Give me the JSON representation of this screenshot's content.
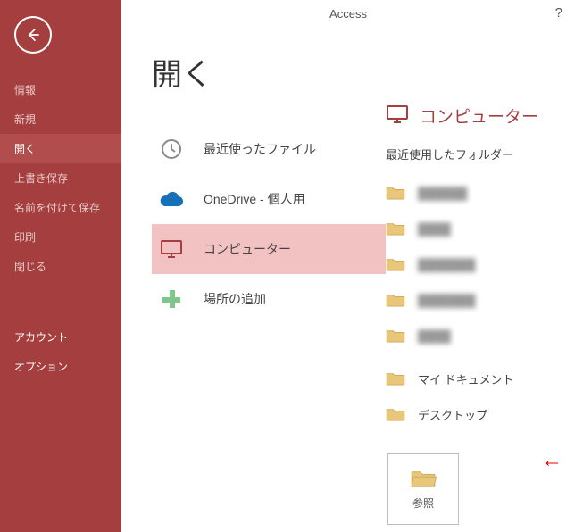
{
  "app_title": "Access",
  "help_symbol": "?",
  "page_title": "開く",
  "sidebar": {
    "items": [
      {
        "label": "情報"
      },
      {
        "label": "新規"
      },
      {
        "label": "開く",
        "active": true
      },
      {
        "label": "上書き保存"
      },
      {
        "label": "名前を付けて保存"
      },
      {
        "label": "印刷"
      },
      {
        "label": "閉じる"
      }
    ],
    "bottom": [
      {
        "label": "アカウント"
      },
      {
        "label": "オプション"
      }
    ]
  },
  "locations": [
    {
      "icon": "clock",
      "label": "最近使ったファイル"
    },
    {
      "icon": "cloud",
      "label": "OneDrive - 個人用"
    },
    {
      "icon": "monitor",
      "label": "コンピューター",
      "selected": true
    },
    {
      "icon": "plus",
      "label": "場所の追加"
    }
  ],
  "right": {
    "title": "コンピューター",
    "recent_label": "最近使用したフォルダー",
    "recent_folders": [
      {
        "name": "██████"
      },
      {
        "name": "████"
      },
      {
        "name": "███████"
      },
      {
        "name": "███████"
      },
      {
        "name": "████"
      }
    ],
    "fixed_folders": [
      {
        "name": "マイ ドキュメント"
      },
      {
        "name": "デスクトップ"
      }
    ],
    "browse_label": "参照"
  },
  "arrow_glyph": "←"
}
